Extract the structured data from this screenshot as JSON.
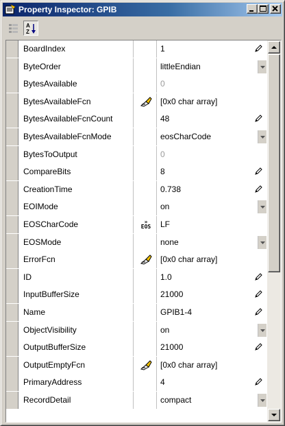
{
  "window": {
    "title": "Property Inspector:  GPIB"
  },
  "toolbar": {
    "categorized_icon": "categorized-view-icon",
    "sort_icon": "sort-alphabetical-icon"
  },
  "properties": [
    {
      "name": "BoardIndex",
      "value": "1",
      "control": "edit"
    },
    {
      "name": "ByteOrder",
      "value": "littleEndian",
      "control": "dropdown"
    },
    {
      "name": "BytesAvailable",
      "value": "0",
      "control": "readonly"
    },
    {
      "name": "BytesAvailableFcn",
      "value": "[0x0  char array]",
      "control": "callback"
    },
    {
      "name": "BytesAvailableFcnCount",
      "value": "48",
      "control": "edit"
    },
    {
      "name": "BytesAvailableFcnMode",
      "value": "eosCharCode",
      "control": "dropdown"
    },
    {
      "name": "BytesToOutput",
      "value": "0",
      "control": "readonly"
    },
    {
      "name": "CompareBits",
      "value": "8",
      "control": "edit"
    },
    {
      "name": "CreationTime",
      "value": "0.738",
      "control": "edit"
    },
    {
      "name": "EOIMode",
      "value": "on",
      "control": "dropdown"
    },
    {
      "name": "EOSCharCode",
      "value": "LF",
      "control": "eos"
    },
    {
      "name": "EOSMode",
      "value": "none",
      "control": "dropdown"
    },
    {
      "name": "ErrorFcn",
      "value": "[0x0  char array]",
      "control": "callback"
    },
    {
      "name": "ID",
      "value": "1.0",
      "control": "edit"
    },
    {
      "name": "InputBufferSize",
      "value": "21000",
      "control": "edit"
    },
    {
      "name": "Name",
      "value": "GPIB1-4",
      "control": "edit"
    },
    {
      "name": "ObjectVisibility",
      "value": "on",
      "control": "dropdown"
    },
    {
      "name": "OutputBufferSize",
      "value": "21000",
      "control": "edit"
    },
    {
      "name": "OutputEmptyFcn",
      "value": "[0x0  char array]",
      "control": "callback"
    },
    {
      "name": "PrimaryAddress",
      "value": "4",
      "control": "edit"
    },
    {
      "name": "RecordDetail",
      "value": "compact",
      "control": "dropdown"
    }
  ],
  "eos_icon_text": {
    "top": "»",
    "bottom": "EOS"
  },
  "colors": {
    "title_start": "#0a246a",
    "title_end": "#a6caf0",
    "face": "#d4d0c8",
    "readonly_text": "#9a9a9a"
  }
}
